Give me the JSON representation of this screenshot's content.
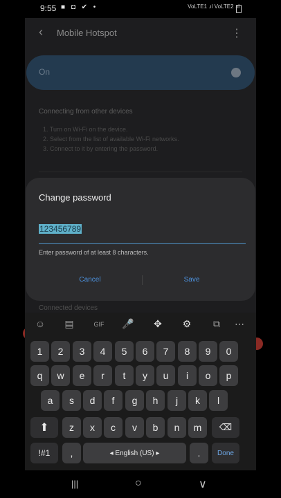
{
  "status": {
    "time": "9:55",
    "left_icons": "■ ◘ ✔ •",
    "right_icons": "VoLTE1 .ıl VoLTE2 .ıl"
  },
  "app": {
    "title": "Mobile Hotspot",
    "toggle_label": "On",
    "section_title": "Connecting from other devices",
    "steps": [
      "1. Turn on Wi-Fi on the device.",
      "2. Select from the list of available Wi-Fi networks.",
      "3. Connect to it by entering the password."
    ],
    "connected_label": "Connected devices"
  },
  "dialog": {
    "title": "Change password",
    "password_value": "123456789",
    "hint": "Enter password of at least 8 characters.",
    "cancel_label": "Cancel",
    "save_label": "Save"
  },
  "keyboard": {
    "toolbar": [
      "☺",
      "▤",
      "GIF",
      "🎤",
      "✥",
      "⚙",
      "⧉",
      "⋯"
    ],
    "row1": [
      "1",
      "2",
      "3",
      "4",
      "5",
      "6",
      "7",
      "8",
      "9",
      "0"
    ],
    "row2": [
      "q",
      "w",
      "e",
      "r",
      "t",
      "y",
      "u",
      "i",
      "o",
      "p"
    ],
    "row3": [
      "a",
      "s",
      "d",
      "f",
      "g",
      "h",
      "j",
      "k",
      "l"
    ],
    "row4": [
      "z",
      "x",
      "c",
      "v",
      "b",
      "n",
      "m"
    ],
    "sym_label": "!#1",
    "comma": ",",
    "space_label": "◂  English (US)  ▸",
    "period": ".",
    "done_label": "Done"
  },
  "nav": {
    "recent": "|||",
    "home": "○",
    "back": "∨"
  }
}
